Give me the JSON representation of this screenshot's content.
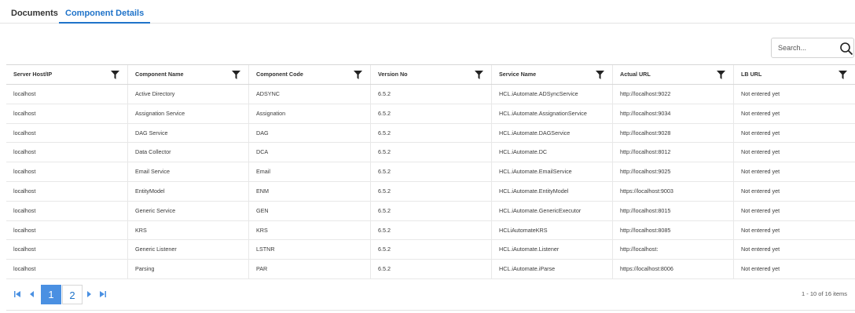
{
  "tabs": [
    {
      "label": "Documents"
    },
    {
      "label": "Component Details"
    }
  ],
  "search": {
    "placeholder": "Search..."
  },
  "table": {
    "columns": [
      "Server Host/IP",
      "Component Name",
      "Component Code",
      "Version No",
      "Service Name",
      "Actual URL",
      "LB URL"
    ],
    "rows": [
      [
        "localhost",
        "Active Directory",
        "ADSYNC",
        "6.5.2",
        "HCL.iAutomate.ADSyncService",
        "http://localhost:9022",
        "Not entered yet"
      ],
      [
        "localhost",
        "Assignation Service",
        "Assignation",
        "6.5.2",
        "HCL.iAutomate.AssignationService",
        "http://localhost:9034",
        "Not entered yet"
      ],
      [
        "localhost",
        "DAG Service",
        "DAG",
        "6.5.2",
        "HCL.iAutomate.DAGService",
        "http://localhost:9028",
        "Not entered yet"
      ],
      [
        "localhost",
        "Data Collector",
        "DCA",
        "6.5.2",
        "HCL.iAutomate.DC",
        "http://localhost:8012",
        "Not entered yet"
      ],
      [
        "localhost",
        "Email Service",
        "Email",
        "6.5.2",
        "HCL.iAutomate.EmailService",
        "http://localhost:9025",
        "Not entered yet"
      ],
      [
        "localhost",
        "EntityModel",
        "ENM",
        "6.5.2",
        "HCL.iAutomate.EntityModel",
        "https://localhost:9003",
        "Not entered yet"
      ],
      [
        "localhost",
        "Generic Service",
        "GEN",
        "6.5.2",
        "HCL.iAutomate.GenericExecutor",
        "http://localhost:8015",
        "Not entered yet"
      ],
      [
        "localhost",
        "KRS",
        "KRS",
        "6.5.2",
        "HCLiAutomateKRS",
        "http://localhost:8085",
        "Not entered yet"
      ],
      [
        "localhost",
        "Generic Listener",
        "LSTNR",
        "6.5.2",
        "HCL.iAutomate.Listener",
        "http://localhost:",
        "Not entered yet"
      ],
      [
        "localhost",
        "Parsing",
        "PAR",
        "6.5.2",
        "HCL.iAutomate.iParse",
        "https://localhost:8006",
        "Not entered yet"
      ]
    ]
  },
  "pager": {
    "pages": [
      "1",
      "2"
    ],
    "current_page": "1",
    "items_text": "1 - 10 of 16 items"
  },
  "colors": {
    "accent": "#1f73c9",
    "active_page": "#4a90e2"
  }
}
